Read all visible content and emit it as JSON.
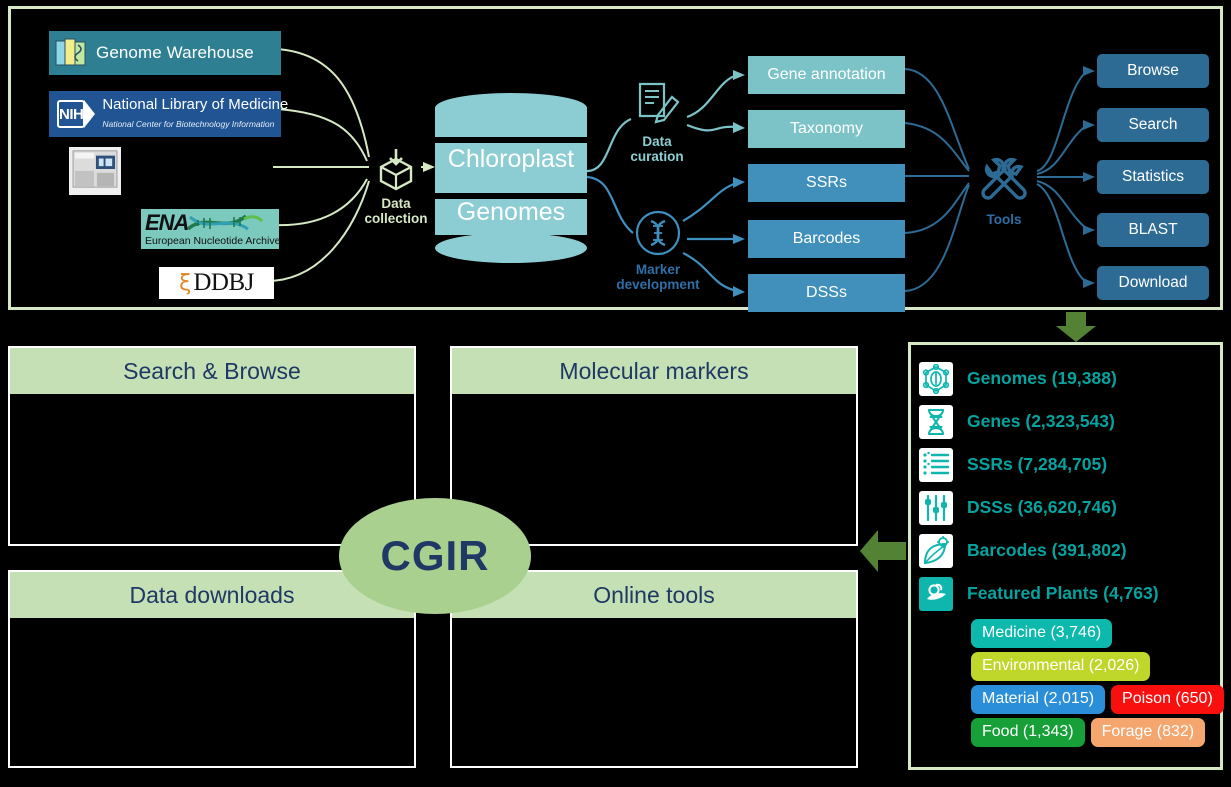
{
  "top_panel": {
    "sources": [
      {
        "name": "Genome Warehouse",
        "icon": "books-dna-icon"
      },
      {
        "name": "National Library of Medicine",
        "subtitle": "National Center for Biotechnology Information",
        "badge": "NIH",
        "icon": "nih-logo-icon"
      },
      {
        "name": "Sequencer",
        "icon": "sequencer-machine-icon"
      },
      {
        "name": "ENA",
        "subtitle": "European Nucleotide Archive",
        "icon": "ena-dna-icon"
      },
      {
        "name": "DDBJ",
        "icon": "ddbj-logo-icon"
      }
    ],
    "nodes": {
      "collection": {
        "line1": "Data",
        "line2": "collection",
        "icon": "data-collection-cube-icon"
      },
      "curation": {
        "line1": "Data",
        "line2": "curation",
        "icon": "document-pencil-icon"
      },
      "marker": {
        "line1": "Marker",
        "line2": "development",
        "icon": "dna-circle-icon"
      },
      "tools": {
        "line1": "Tools",
        "line2": "",
        "icon": "wrench-screwdriver-icon"
      }
    },
    "database": {
      "line1": "Chloroplast",
      "line2": "Genomes"
    },
    "process_boxes": [
      {
        "label": "Gene annotation",
        "tone": "light"
      },
      {
        "label": "Taxonomy",
        "tone": "light"
      },
      {
        "label": "SSRs",
        "tone": "dark"
      },
      {
        "label": "Barcodes",
        "tone": "dark"
      },
      {
        "label": "DSSs",
        "tone": "dark"
      }
    ],
    "action_buttons": [
      {
        "label": "Browse"
      },
      {
        "label": "Search"
      },
      {
        "label": "Statistics"
      },
      {
        "label": "BLAST"
      },
      {
        "label": "Download"
      }
    ]
  },
  "bottom_panel": {
    "center_label": "CGIR",
    "quadrants": [
      {
        "title": "Search & Browse"
      },
      {
        "title": "Molecular markers"
      },
      {
        "title": "Data downloads"
      },
      {
        "title": "Online tools"
      }
    ]
  },
  "stats": {
    "rows": [
      {
        "label": "Genomes (19,388)",
        "icon": "genome-network-icon"
      },
      {
        "label": "Genes (2,323,543)",
        "icon": "dna-helix-icon"
      },
      {
        "label": "SSRs (7,284,705)",
        "icon": "list-lines-icon"
      },
      {
        "label": "DSSs (36,620,746)",
        "icon": "sliders-icon"
      },
      {
        "label": "Barcodes (391,802)",
        "icon": "leaf-gear-icon"
      },
      {
        "label": "Featured Plants (4,763)",
        "icon": "plant-hand-circle-icon"
      }
    ],
    "tags": [
      [
        {
          "label": "Medicine (3,746)",
          "color": "#0db8ac"
        }
      ],
      [
        {
          "label": "Environmental (2,026)",
          "color": "#bfd62a"
        }
      ],
      [
        {
          "label": "Material (2,015)",
          "color": "#2a8fd8"
        },
        {
          "label": "Poison (650)",
          "color": "#fa0f0f"
        }
      ],
      [
        {
          "label": "Food (1,343)",
          "color": "#17a038"
        },
        {
          "label": "Forage (832)",
          "color": "#f5a66e"
        }
      ]
    ]
  },
  "colors": {
    "frame_green": "#d6e8c4",
    "header_green": "#c5e0b4",
    "cgir_green": "#a9d08e",
    "arrow_green": "#548235",
    "navy": "#1f3864",
    "teal_box": "#7cc3c8",
    "blue_box": "#4090bb",
    "button_blue": "#2d6b95",
    "cylinder": "#8bcdd3",
    "stat_teal": "#05a3a0"
  }
}
